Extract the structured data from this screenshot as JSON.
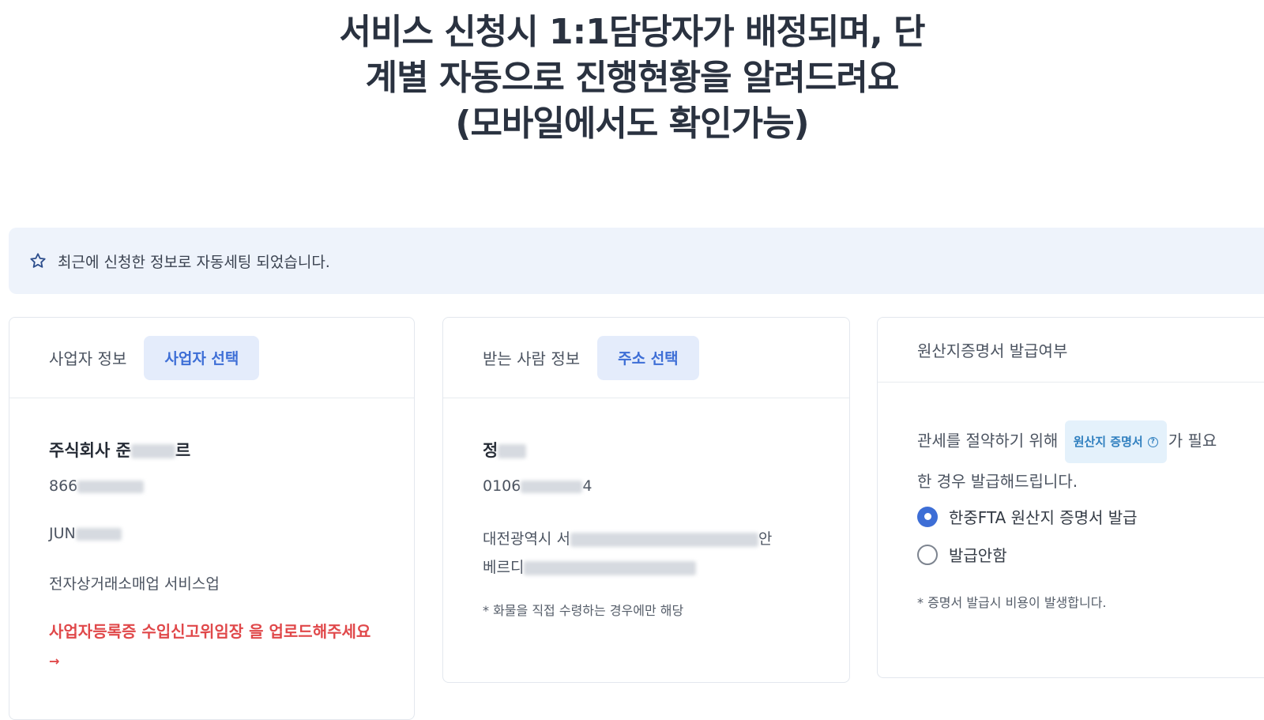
{
  "headline": {
    "line1": "서비스 신청시 1:1담당자가 배정되며, 단",
    "line2": "계별 자동으로 진행현황을 알려드려요",
    "line3": "(모바일에서도 확인가능)"
  },
  "banner": {
    "icon": "star-icon",
    "text": "최근에 신청한 정보로 자동세팅 되었습니다."
  },
  "business_card": {
    "title": "사업자 정보",
    "button": "사업자 선택",
    "company_prefix": "주식회사 준",
    "company_suffix": "르",
    "reg_no_prefix": "866",
    "name_prefix": "JUN",
    "category": "전자상거래소매업 서비스업",
    "upload_warning": "사업자등록증 수입신고위임장 을 업로드해주세요",
    "upload_arrow": "→"
  },
  "recipient_card": {
    "title": "받는 사람 정보",
    "button": "주소 선택",
    "name_prefix": "정",
    "phone_prefix": "0106",
    "phone_suffix": "4",
    "address_prefix": "대전광역시 서",
    "address_mid": "안",
    "address_line2_prefix": "베르디",
    "note": "* 화물을 직접 수령하는 경우에만 해당"
  },
  "origin_card": {
    "title": "원산지증명서 발급여부",
    "desc_before": "관세를 절약하기 위해",
    "chip": "원산지 증명서",
    "chip_icon": "question-circle-icon",
    "desc_after": "가 필요",
    "desc_line2": "한 경우 발급해드립니다.",
    "options": [
      {
        "label": "한중FTA 원산지 증명서 발급",
        "selected": true
      },
      {
        "label": "발급안함",
        "selected": false
      }
    ],
    "note": "* 증명서 발급시 비용이 발생합니다."
  }
}
